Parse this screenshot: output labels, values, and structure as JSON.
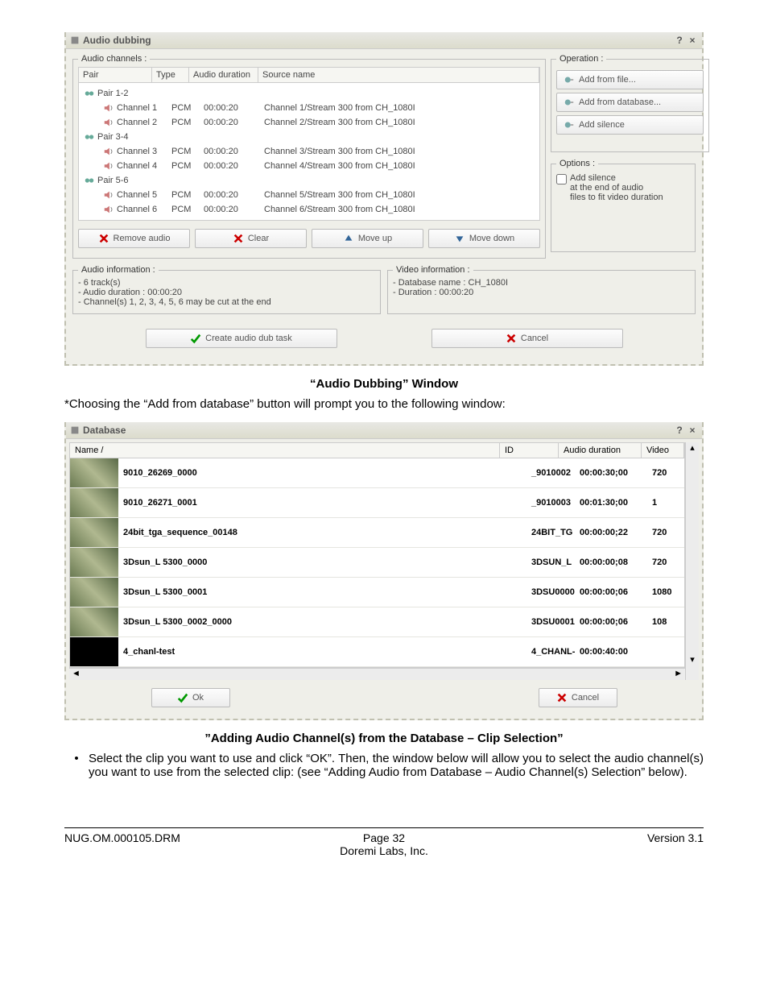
{
  "win1": {
    "title": "Audio dubbing",
    "audioChannels": {
      "legend": "Audio channels :",
      "headers": {
        "pair": "Pair",
        "type": "Type",
        "dur": "Audio duration",
        "src": "Source name"
      },
      "pairs": [
        {
          "label": "Pair 1-2",
          "children": [
            {
              "name": "Channel 1",
              "type": "PCM",
              "dur": "00:00:20",
              "src": "Channel 1/Stream 300  from CH_1080I"
            },
            {
              "name": "Channel 2",
              "type": "PCM",
              "dur": "00:00:20",
              "src": "Channel 2/Stream 300  from CH_1080I"
            }
          ]
        },
        {
          "label": "Pair 3-4",
          "children": [
            {
              "name": "Channel 3",
              "type": "PCM",
              "dur": "00:00:20",
              "src": "Channel 3/Stream 300  from CH_1080I"
            },
            {
              "name": "Channel 4",
              "type": "PCM",
              "dur": "00:00:20",
              "src": "Channel 4/Stream 300  from CH_1080I"
            }
          ]
        },
        {
          "label": "Pair 5-6",
          "children": [
            {
              "name": "Channel 5",
              "type": "PCM",
              "dur": "00:00:20",
              "src": "Channel 5/Stream 300  from CH_1080I"
            },
            {
              "name": "Channel 6",
              "type": "PCM",
              "dur": "00:00:20",
              "src": "Channel 6/Stream 300  from CH_1080I"
            }
          ]
        }
      ],
      "btns": {
        "remove": "Remove audio",
        "clear": "Clear",
        "moveup": "Move up",
        "movedown": "Move down"
      }
    },
    "operation": {
      "legend": "Operation :",
      "addFile": "Add from file...",
      "addDb": "Add from database...",
      "addSilence": "Add silence"
    },
    "options": {
      "legend": "Options :",
      "check": "Add silence\nat the end of audio\nfiles to fit video duration"
    },
    "audioInfo": {
      "legend": "Audio information :",
      "lines": [
        "- 6 track(s)",
        "- Audio duration : 00:00:20",
        "- Channel(s)  1, 2, 3, 4, 5, 6 may be cut at the end"
      ]
    },
    "videoInfo": {
      "legend": "Video information :",
      "lines": [
        "- Database name : CH_1080I",
        "- Duration : 00:00:20"
      ]
    },
    "bottom": {
      "create": "Create audio dub task",
      "cancel": "Cancel"
    }
  },
  "caption1": "“Audio Dubbing” Window",
  "para1": "*Choosing the “Add from database” button will prompt you to the following window:",
  "win2": {
    "title": "Database",
    "headers": {
      "name": "Name    /",
      "id": "ID",
      "ad": "Audio duration",
      "vid": "Video"
    },
    "rows": [
      {
        "name": "9010_26269_0000",
        "id": "_9010002",
        "dur": "00:00:30;00",
        "vid": "720"
      },
      {
        "name": "9010_26271_0001",
        "id": "_9010003",
        "dur": "00:01:30;00",
        "vid": "1"
      },
      {
        "name": "24bit_tga_sequence_00148",
        "id": "24BIT_TG",
        "dur": "00:00:00;22",
        "vid": "720"
      },
      {
        "name": "3Dsun_L 5300_0000",
        "id": "3DSUN_L",
        "dur": "00:00:00;08",
        "vid": "720"
      },
      {
        "name": "3Dsun_L 5300_0001",
        "id": "3DSU0000",
        "dur": "00:00:00;06",
        "vid": "1080"
      },
      {
        "name": "3Dsun_L 5300_0002_0000",
        "id": "3DSU0001",
        "dur": "00:00:00;06",
        "vid": "108"
      },
      {
        "name": "4_chanl-test",
        "id": "4_CHANL-",
        "dur": "00:00:40:00",
        "vid": ""
      }
    ],
    "ok": "Ok",
    "cancel": "Cancel"
  },
  "caption2": "”Adding Audio Channel(s) from the Database – Clip Selection”",
  "bullet": "Select the clip you want to use and click “OK”. Then, the window below will allow you to select the audio channel(s) you want to use from the selected clip: (see “Adding Audio from Database – Audio Channel(s) Selection” below).",
  "footer": {
    "left": "NUG.OM.000105.DRM",
    "centerLine1": "Page 32",
    "centerLine2": "Doremi Labs, Inc.",
    "right": "Version 3.1"
  }
}
